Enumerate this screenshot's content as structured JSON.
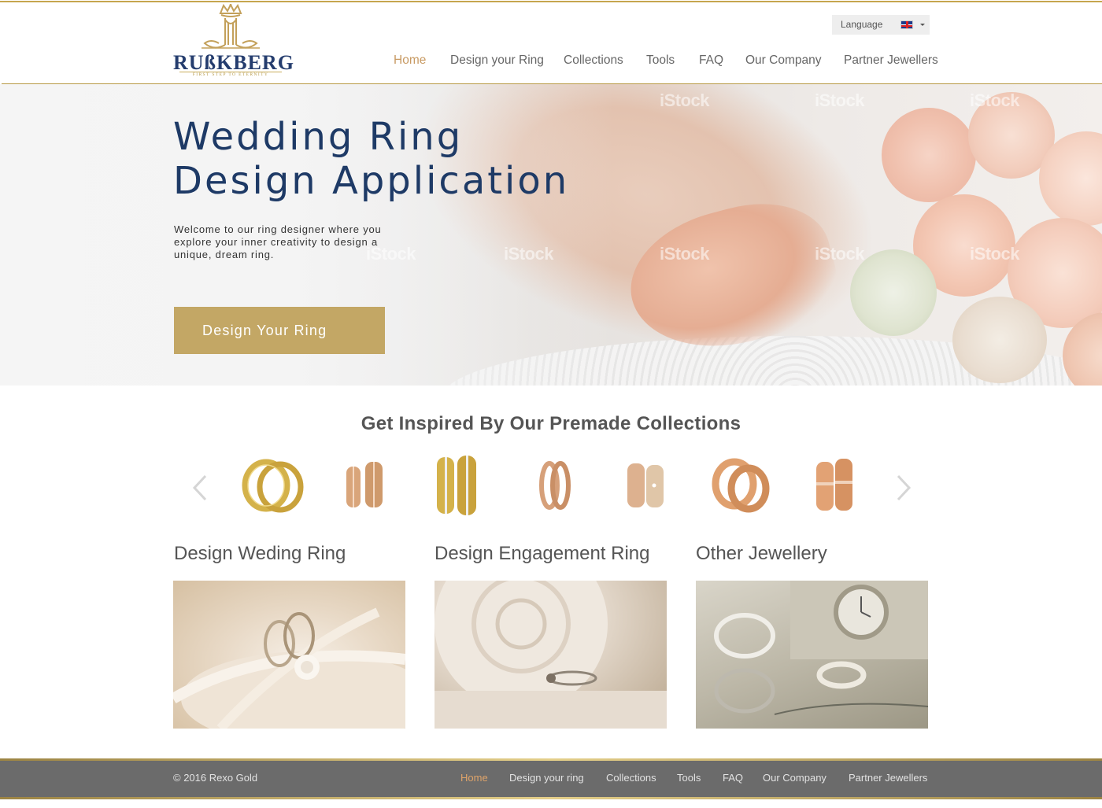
{
  "brand": {
    "name": "RUßKBERG",
    "tagline": "FIRST STEP TO ETERNITY"
  },
  "language": {
    "label": "Language",
    "flag": "uk-flag-icon"
  },
  "nav": {
    "items": [
      {
        "label": "Home",
        "active": true
      },
      {
        "label": "Design your Ring",
        "active": false
      },
      {
        "label": "Collections",
        "active": false
      },
      {
        "label": "Tools",
        "active": false
      },
      {
        "label": "FAQ",
        "active": false
      },
      {
        "label": "Our Company",
        "active": false
      },
      {
        "label": "Partner Jewellers",
        "active": false
      }
    ]
  },
  "hero": {
    "title_line1": "Wedding Ring",
    "title_line2": "Design Application",
    "text": "Welcome to our ring designer where you explore your inner creativity to design a unique, dream ring.",
    "button": "Design Your Ring",
    "watermark": "iStock"
  },
  "collections": {
    "title": "Get Inspired By Our Premade Collections",
    "prev": "chevron-left-icon",
    "next": "chevron-right-icon",
    "rings": [
      {
        "name": "yellow-gold-pair-ring",
        "color": "#d4b24a"
      },
      {
        "name": "rose-gold-textured-ring",
        "color": "#d9a57a"
      },
      {
        "name": "yellow-gold-diamond-ring",
        "color": "#d4b24a"
      },
      {
        "name": "rose-gold-thin-ring",
        "color": "#d6a07a"
      },
      {
        "name": "rose-gold-hammered-ring",
        "color": "#ddb18f"
      },
      {
        "name": "rose-gold-pair-ring",
        "color": "#e0a06e"
      },
      {
        "name": "rose-gold-stripe-ring",
        "color": "#e2a274"
      }
    ]
  },
  "cards": [
    {
      "title": "Design Weding Ring"
    },
    {
      "title": "Design Engagement Ring"
    },
    {
      "title": "Other Jewellery"
    }
  ],
  "footer": {
    "copyright": "© 2016 Rexo Gold",
    "nav": [
      {
        "label": "Home",
        "active": true
      },
      {
        "label": "Design your ring",
        "active": false
      },
      {
        "label": "Collections",
        "active": false
      },
      {
        "label": "Tools",
        "active": false
      },
      {
        "label": "FAQ",
        "active": false
      },
      {
        "label": "Our Company",
        "active": false
      },
      {
        "label": "Partner Jewellers",
        "active": false
      }
    ]
  },
  "colors": {
    "accent": "#c3a765",
    "navy": "#1e3a66",
    "active_nav": "#c89a63"
  }
}
